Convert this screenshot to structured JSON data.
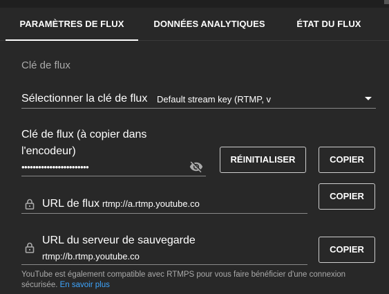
{
  "tabs": [
    {
      "label": "PARAMÈTRES DE FLUX",
      "active": true
    },
    {
      "label": "DONNÉES ANALYTIQUES",
      "active": false
    },
    {
      "label": "ÉTAT DU FLUX",
      "active": false
    }
  ],
  "stream_key_section": {
    "title": "Clé de flux",
    "select_label": "Sélectionner la clé de flux",
    "select_value": "Default stream key (RTMP, v",
    "key_label": "Clé de flux (à copier dans l'encodeur)",
    "key_masked": "••••••••••••••••••••••••",
    "reset_button": "RÉINITIALISER",
    "copy_button": "COPIER"
  },
  "stream_url": {
    "label": "URL de flux",
    "value": "rtmp://a.rtmp.youtube.co",
    "copy_button": "COPIER"
  },
  "backup_url": {
    "label": "URL du serveur de sauvegarde",
    "value": "rtmp://b.rtmp.youtube.co",
    "copy_button": "COPIER"
  },
  "footnote": {
    "text": "YouTube est également compatible avec RTMPS pour vous faire bénéficier d'une connexion sécurisée. ",
    "link": "En savoir plus"
  },
  "icons": {
    "visibility": "visibility-off-icon",
    "lock": "lock-icon",
    "dropdown": "chevron-down-icon"
  },
  "colors": {
    "background": "#282828",
    "link": "#3ea6ff",
    "muted_text": "#aaaaaa"
  }
}
